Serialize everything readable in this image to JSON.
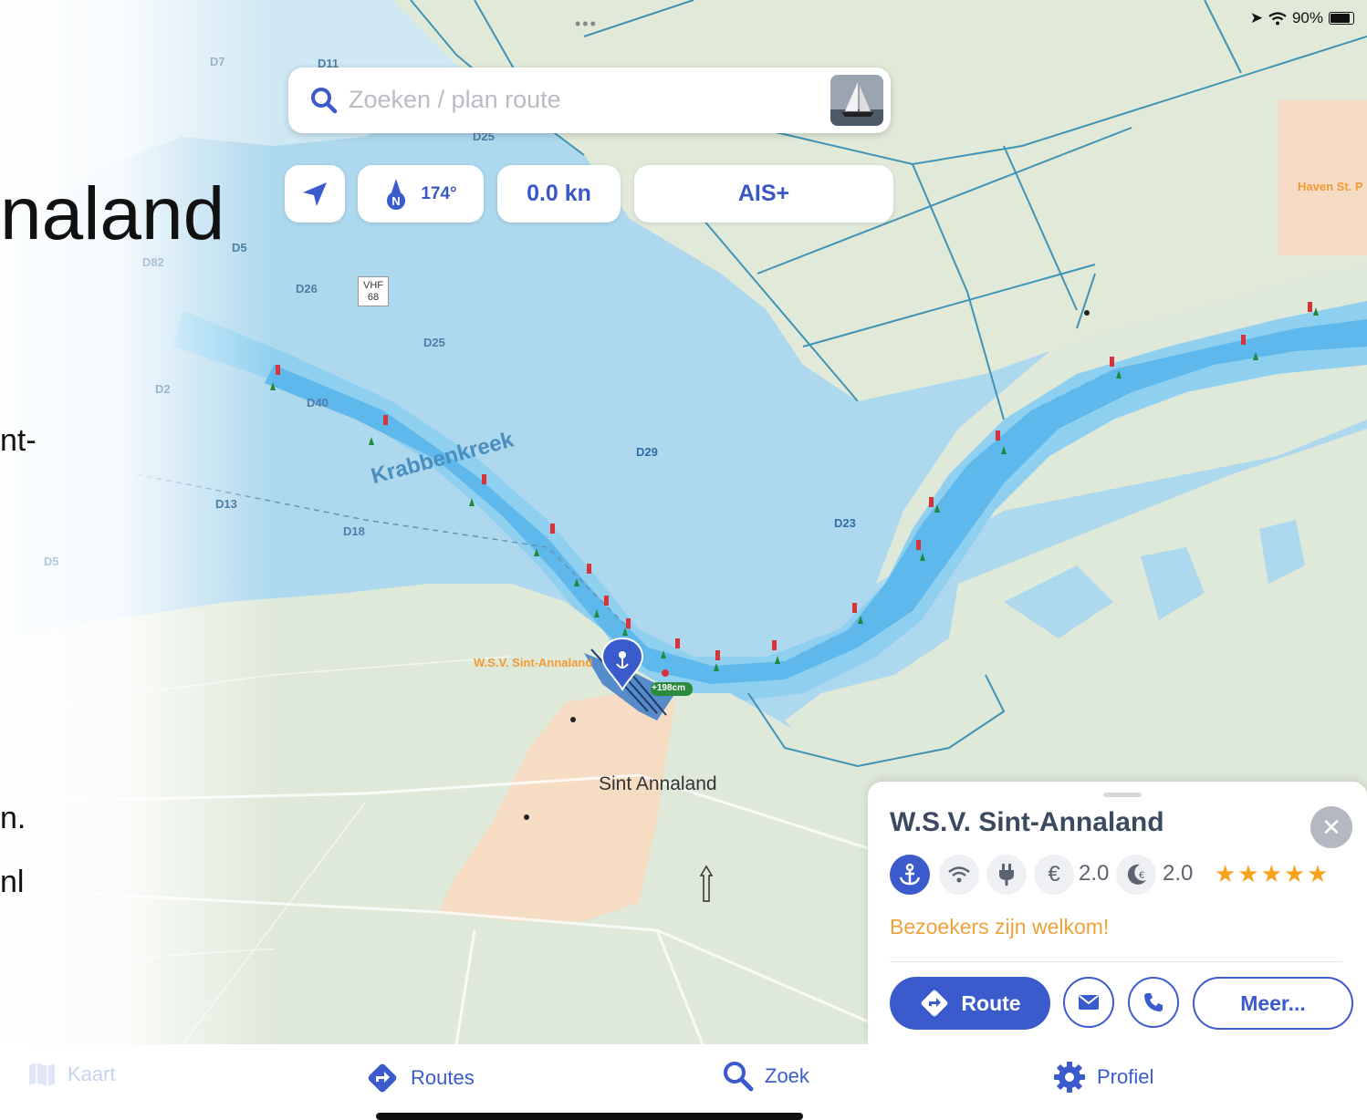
{
  "status_bar": {
    "battery": "90%"
  },
  "ghost_text": {
    "line1": "naland",
    "line2": "nt-",
    "line3": "n.",
    "line4": "nl"
  },
  "search": {
    "placeholder": "Zoeken / plan route"
  },
  "controls": {
    "heading": "174°",
    "speed": "0.0 kn",
    "ais": "AIS+"
  },
  "map": {
    "water_name": "Krabbenkreek",
    "town": "Sint Annaland",
    "marina_label": "W.S.V. Sint-Annaland",
    "harbour_label": "Haven St. P",
    "tide_badge": "+198cm",
    "vhf_top": "VHF",
    "vhf_bottom": "68",
    "depth_labels": {
      "d7": "D7",
      "d11": "D11",
      "d25_top": "D25",
      "d5": "D5",
      "d82": "D82",
      "d26": "D26",
      "d25": "D25",
      "d2": "D2",
      "d40": "D40",
      "d29": "D29",
      "d13": "D13",
      "d18": "D18",
      "d23": "D23",
      "d5b": "D5"
    }
  },
  "sheet": {
    "title": "W.S.V. Sint-Annaland",
    "price_day": "2.0",
    "price_night": "2.0",
    "stars": "★★★★★",
    "rating": 5,
    "welcome": "Bezoekers zijn welkom!",
    "route_label": "Route",
    "more_label": "Meer..."
  },
  "tabs": {
    "map": "Kaart",
    "routes": "Routes",
    "search": "Zoek",
    "profile": "Profiel"
  },
  "colors": {
    "accent": "#3b5bcc",
    "water": "#8fd0f0",
    "channel": "#5fb8ec",
    "land": "#dfe9d9",
    "town": "#f5dcc3",
    "warning": "#f0a23a",
    "stars": "#f7a21b"
  }
}
